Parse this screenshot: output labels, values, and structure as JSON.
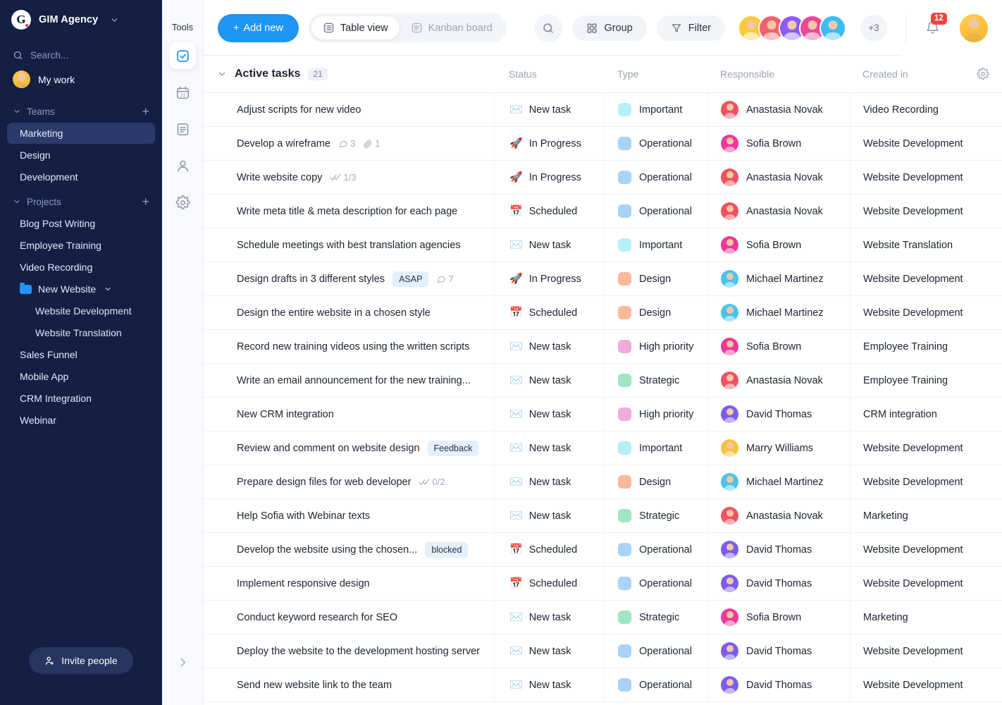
{
  "sidebar": {
    "brand": {
      "logo_letter": "G",
      "name": "GIM Agency",
      "caret_icon": "chevron-down-icon"
    },
    "search_placeholder": "Search...",
    "my_work_label": "My work",
    "teams": {
      "label": "Teams",
      "add_icon": "plus-icon",
      "items": [
        "Marketing",
        "Design",
        "Development"
      ],
      "active": "Marketing"
    },
    "projects": {
      "label": "Projects",
      "add_icon": "plus-icon",
      "items": [
        {
          "label": "Blog Post Writing",
          "type": "project"
        },
        {
          "label": "Employee Training",
          "type": "project"
        },
        {
          "label": "Video Recording",
          "type": "project"
        },
        {
          "label": "New Website",
          "type": "folder",
          "expanded": true
        },
        {
          "label": "Website Development",
          "type": "sub"
        },
        {
          "label": "Website Translation",
          "type": "sub"
        },
        {
          "label": "Sales Funnel",
          "type": "project"
        },
        {
          "label": "Mobile App",
          "type": "project"
        },
        {
          "label": "CRM Integration",
          "type": "project"
        },
        {
          "label": "Webinar",
          "type": "project"
        }
      ]
    },
    "invite_label": "Invite people"
  },
  "tools": {
    "label": "Tools",
    "items": [
      {
        "name": "tasks-icon",
        "active": true
      },
      {
        "name": "calendar-icon",
        "active": false
      },
      {
        "name": "document-icon",
        "active": false
      },
      {
        "name": "contacts-icon",
        "active": false
      },
      {
        "name": "settings-icon",
        "active": false
      }
    ],
    "expand_icon": "chevron-right-icon"
  },
  "topbar": {
    "add_new_label": "Add new",
    "views": [
      {
        "label": "Table view",
        "icon": "table-icon",
        "active": true
      },
      {
        "label": "Kanban board",
        "icon": "kanban-icon",
        "active": false
      }
    ],
    "search_icon": "search-icon",
    "group_label": "Group",
    "filter_label": "Filter",
    "avatar_colors": [
      "#ffc93c",
      "#f4606c",
      "#8b5cf6",
      "#ec4899",
      "#38bdf8"
    ],
    "avatar_overflow": "+3",
    "notification_count": "12",
    "bell_icon": "bell-icon"
  },
  "table": {
    "group_title": "Active tasks",
    "group_count": "21",
    "collapse_icon": "chevron-down-icon",
    "settings_icon": "gear-icon",
    "columns": [
      "Status",
      "Type",
      "Responsible",
      "Created in"
    ],
    "type_colors": {
      "Important": "#b5f0fa",
      "Operational": "#a8d3f7",
      "Design": "#fbb89c",
      "High priority": "#efaade",
      "Strategic": "#9fe6c3"
    },
    "avatar_colors": {
      "Anastasia Novak": "#f4505f",
      "Sofia Brown": "#f0369b",
      "Michael Martinez": "#4cc2ef",
      "David Thomas": "#7c5cf0",
      "Marry Williams": "#f7c23c"
    },
    "status_icons": {
      "New task": "✉️",
      "In Progress": "🚀",
      "Scheduled": "📅"
    },
    "rows": [
      {
        "task": "Adjust scripts for new video",
        "status": "New task",
        "type": "Important",
        "responsible": "Anastasia Novak",
        "created_in": "Video Recording"
      },
      {
        "task": "Develop a wireframe",
        "comments": "3",
        "attachments": "1",
        "status": "In Progress",
        "type": "Operational",
        "responsible": "Sofia Brown",
        "created_in": "Website Development"
      },
      {
        "task": "Write website copy",
        "subtasks": "1/3",
        "status": "In Progress",
        "type": "Operational",
        "responsible": "Anastasia Novak",
        "created_in": "Website Development"
      },
      {
        "task": "Write meta title & meta description for each page",
        "status": "Scheduled",
        "type": "Operational",
        "responsible": "Anastasia Novak",
        "created_in": "Website Development"
      },
      {
        "task": "Schedule meetings with best translation agencies",
        "status": "New task",
        "type": "Important",
        "responsible": "Sofia Brown",
        "created_in": "Website Translation"
      },
      {
        "task": "Design drafts in 3 different styles",
        "badge": "ASAP",
        "comments": "7",
        "status": "In Progress",
        "type": "Design",
        "responsible": "Michael Martinez",
        "created_in": "Website Development"
      },
      {
        "task": "Design the entire website in a chosen style",
        "status": "Scheduled",
        "type": "Design",
        "responsible": "Michael Martinez",
        "created_in": "Website Development"
      },
      {
        "task": "Record new training videos using the written scripts",
        "status": "New task",
        "type": "High priority",
        "responsible": "Sofia Brown",
        "created_in": "Employee Training"
      },
      {
        "task": "Write an email announcement for the new training...",
        "status": "New task",
        "type": "Strategic",
        "responsible": "Anastasia Novak",
        "created_in": "Employee Training"
      },
      {
        "task": "New CRM integration",
        "status": "New task",
        "type": "High priority",
        "responsible": "David Thomas",
        "created_in": "CRM integration"
      },
      {
        "task": "Review and comment on website design",
        "badge": "Feedback",
        "status": "New task",
        "type": "Important",
        "responsible": "Marry Williams",
        "created_in": "Website Development"
      },
      {
        "task": "Prepare design files for web developer",
        "subtasks": "0/2",
        "status": "New task",
        "type": "Design",
        "responsible": "Michael Martinez",
        "created_in": "Website Development"
      },
      {
        "task": "Help Sofia with Webinar texts",
        "status": "New task",
        "type": "Strategic",
        "responsible": "Anastasia Novak",
        "created_in": "Marketing"
      },
      {
        "task": "Develop the website using the chosen...",
        "badge": "blocked",
        "status": "Scheduled",
        "type": "Operational",
        "responsible": "David Thomas",
        "created_in": "Website Development"
      },
      {
        "task": "Implement responsive design",
        "status": "Scheduled",
        "type": "Operational",
        "responsible": "David Thomas",
        "created_in": "Website Development"
      },
      {
        "task": "Conduct keyword research for SEO",
        "status": "New task",
        "type": "Strategic",
        "responsible": "Sofia Brown",
        "created_in": "Marketing"
      },
      {
        "task": "Deploy the website to the development hosting server",
        "status": "New task",
        "type": "Operational",
        "responsible": "David Thomas",
        "created_in": "Website Development"
      },
      {
        "task": "Send new website link to the team",
        "status": "New task",
        "type": "Operational",
        "responsible": "David Thomas",
        "created_in": "Website Development"
      }
    ]
  }
}
